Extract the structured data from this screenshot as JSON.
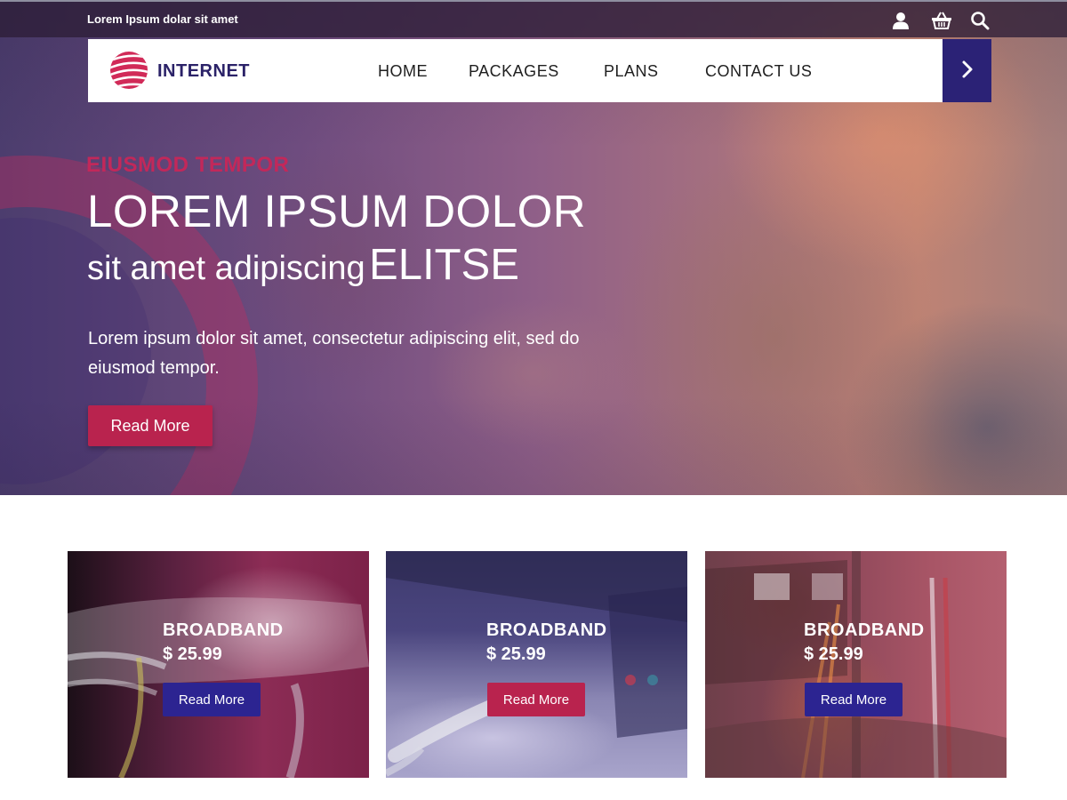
{
  "topbar": {
    "tagline": "Lorem Ipsum dolar sit amet",
    "icons": [
      "user-icon",
      "basket-icon",
      "search-icon"
    ]
  },
  "nav": {
    "logo_text": "INTERNET",
    "items": [
      {
        "label": "HOME"
      },
      {
        "label": "PACKAGES"
      },
      {
        "label": "PLANS"
      },
      {
        "label": "CONTACT US"
      }
    ],
    "next_icon": "chevron-right-icon"
  },
  "hero": {
    "eyebrow": "EIUSMOD TEMPOR",
    "headline_line1": "LOREM IPSUM DOLOR",
    "headline_line2_small": "sit amet adipiscing",
    "headline_line2_big": "ELITSE",
    "lead": "Lorem ipsum dolor sit amet, consectetur adipiscing elit, sed do eiusmod tempor.",
    "button_label": "Read More"
  },
  "cards": [
    {
      "title": "BROADBAND",
      "price": "$ 25.99",
      "button_label": "Read More",
      "button_color": "#2c2491"
    },
    {
      "title": "BROADBAND",
      "price": "$ 25.99",
      "button_label": "Read More",
      "button_color": "#b9234e"
    },
    {
      "title": "BROADBAND",
      "price": "$ 25.99",
      "button_label": "Read More",
      "button_color": "#2c2491"
    }
  ],
  "colors": {
    "brand_navy": "#2b2268",
    "brand_crimson": "#b9234e",
    "eyebrow": "#c2285a"
  }
}
